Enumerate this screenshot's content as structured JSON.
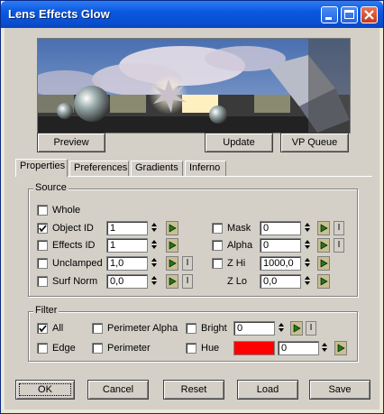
{
  "window": {
    "title": "Lens Effects Glow"
  },
  "title_buttons": {
    "minimize_icon": "minimize-icon",
    "maximize_icon": "maximize-icon",
    "close_icon": "close-icon"
  },
  "preview_buttons": {
    "preview": "Preview",
    "update": "Update",
    "vp_queue": "VP Queue"
  },
  "tabs": [
    {
      "label": "Properties",
      "active": true
    },
    {
      "label": "Preferences",
      "active": false
    },
    {
      "label": "Gradients",
      "active": false
    },
    {
      "label": "Inferno",
      "active": false
    }
  ],
  "source": {
    "group_label": "Source",
    "whole": {
      "label": "Whole",
      "checked": false
    },
    "object_id": {
      "label": "Object ID",
      "checked": true,
      "value": "1"
    },
    "effects_id": {
      "label": "Effects ID",
      "checked": false,
      "value": "1"
    },
    "unclamped": {
      "label": "Unclamped",
      "checked": false,
      "value": "1,0",
      "i_label": "I"
    },
    "surf_norm": {
      "label": "Surf Norm",
      "checked": false,
      "value": "0,0",
      "i_label": "I"
    },
    "mask": {
      "label": "Mask",
      "checked": false,
      "value": "0",
      "i_label": "I"
    },
    "alpha": {
      "label": "Alpha",
      "checked": false,
      "value": "0",
      "i_label": "I"
    },
    "z_hi": {
      "label": "Z Hi",
      "checked": false,
      "value": "1000,0"
    },
    "z_lo": {
      "label": "Z Lo",
      "value": "0,0"
    }
  },
  "filter": {
    "group_label": "Filter",
    "all": {
      "label": "All",
      "checked": true
    },
    "edge": {
      "label": "Edge",
      "checked": false
    },
    "perimeter_alpha": {
      "label": "Perimeter Alpha",
      "checked": false
    },
    "perimeter": {
      "label": "Perimeter",
      "checked": false
    },
    "bright": {
      "label": "Bright",
      "checked": false,
      "value": "0",
      "i_label": "I"
    },
    "hue": {
      "label": "Hue",
      "checked": false,
      "value": "0",
      "swatch_color": "#ff0000"
    }
  },
  "bottom_buttons": {
    "ok": "OK",
    "cancel": "Cancel",
    "reset": "Reset",
    "load": "Load",
    "save": "Save"
  },
  "colors": {
    "title_bar": "#0a58e0",
    "dialog_bg": "#d4d0c8",
    "play_button": "#c8c090"
  }
}
